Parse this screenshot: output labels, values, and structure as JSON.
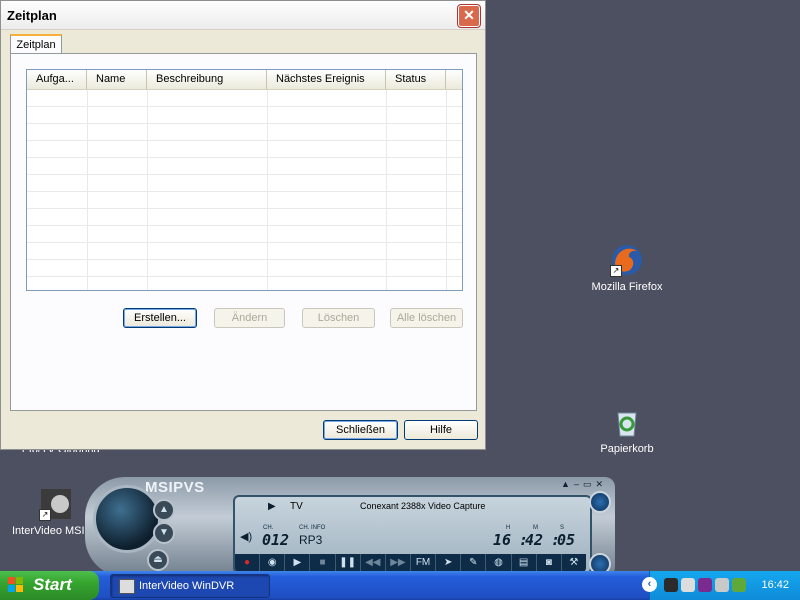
{
  "desktop": {
    "icons": [
      {
        "label": "Mozilla Firefox"
      },
      {
        "label": "Papierkorb"
      },
      {
        "label": "InterVideo MSIP"
      },
      {
        "label": "r Ip/TV Glooring"
      }
    ]
  },
  "dialog": {
    "title": "Zeitplan",
    "tab": "Zeitplan",
    "columns": [
      "Aufga...",
      "Name",
      "Beschreibung",
      "Nächstes Ereignis",
      "Status"
    ],
    "buttons": {
      "create": "Erstellen...",
      "change": "Ändern",
      "delete": "Löschen",
      "delete_all": "Alle löschen",
      "close": "Schließen",
      "help": "Hilfe"
    }
  },
  "player": {
    "brand": "MSIPVS",
    "mode": "TV",
    "device": "Conexant 2388x Video Capture",
    "ch_label": "CH.",
    "ch_info_label": "CH. INFO",
    "channel": "012",
    "channel_info": "RP3",
    "h_label": "H",
    "m_label": "M",
    "s_label": "S",
    "hours": "16",
    "minutes": "42",
    "seconds": "05",
    "fm_label": "FM"
  },
  "taskbar": {
    "start": "Start",
    "task": "InterVideo WinDVR",
    "clock": "16:42"
  }
}
